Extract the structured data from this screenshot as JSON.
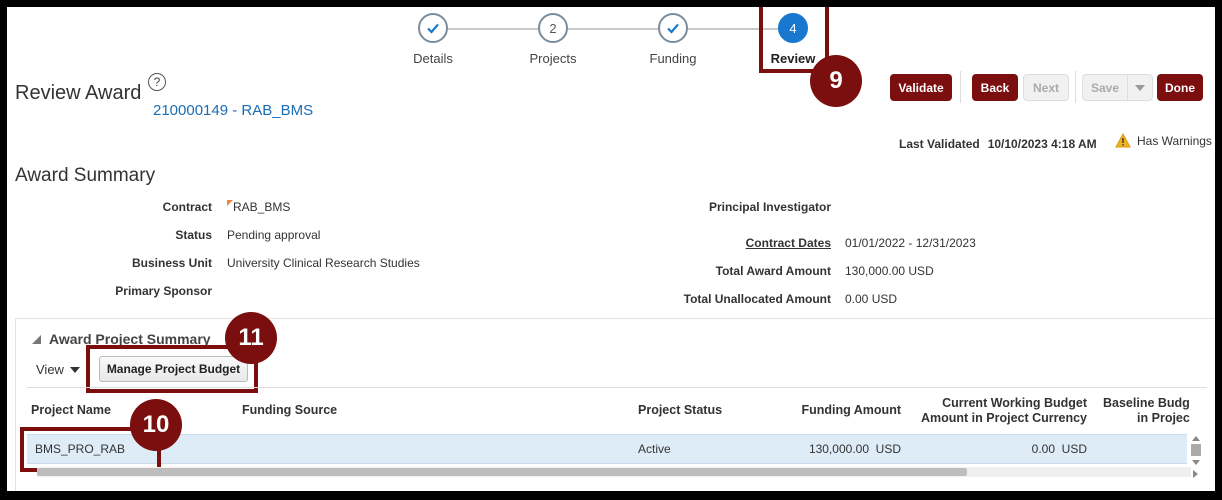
{
  "train": {
    "stops": [
      {
        "label": "Details",
        "state": "done"
      },
      {
        "label": "Projects",
        "number": "2",
        "state": "pending"
      },
      {
        "label": "Funding",
        "state": "done"
      },
      {
        "label": "Review",
        "number": "4",
        "state": "current"
      }
    ]
  },
  "callouts": {
    "review": "9",
    "manage_budget": "11",
    "project_name": "10"
  },
  "header": {
    "title": "Review Award",
    "help_icon": "?",
    "award_link": "210000149 - RAB_BMS"
  },
  "toolbar": {
    "validate": "Validate",
    "back": "Back",
    "next": "Next",
    "save": "Save",
    "done": "Done"
  },
  "validation": {
    "label": "Last Validated",
    "timestamp": "10/10/2023 4:18 AM",
    "warnings": "Has Warnings"
  },
  "summary": {
    "title": "Award Summary",
    "left": [
      {
        "label": "Contract",
        "value": "RAB_BMS"
      },
      {
        "label": "Status",
        "value": "Pending approval"
      },
      {
        "label": "Business Unit",
        "value": "University Clinical Research Studies"
      },
      {
        "label": "Primary Sponsor",
        "value": ""
      }
    ],
    "right": [
      {
        "label": "Principal Investigator",
        "value": ""
      },
      {
        "label": "Contract Dates",
        "value": "01/01/2022 - 12/31/2023"
      },
      {
        "label": "Total Award Amount",
        "value": "130,000.00  USD"
      },
      {
        "label": "Total Unallocated Amount",
        "value": "0.00  USD"
      }
    ]
  },
  "project_summary": {
    "title": "Award Project Summary",
    "view": "View",
    "manage_button": "Manage Project Budget",
    "columns": {
      "project_name": "Project Name",
      "funding_source": "Funding Source",
      "project_status": "Project Status",
      "funding_amount": "Funding Amount",
      "cwb_line1": "Current Working Budget",
      "cwb_line2": "Amount in Project Currency",
      "baseline_line1": "Baseline Budg",
      "baseline_line2": "in Projec"
    },
    "rows": [
      {
        "project_name": "BMS_PRO_RAB",
        "funding_source": "",
        "project_status": "Active",
        "funding_amount": "130,000.00  USD",
        "cwb_amount": "0.00  USD"
      }
    ]
  },
  "colors": {
    "brand": "#7b0e0e",
    "accent": "#1878d0",
    "link": "#1a6db3",
    "selected_row": "#deecf8"
  }
}
